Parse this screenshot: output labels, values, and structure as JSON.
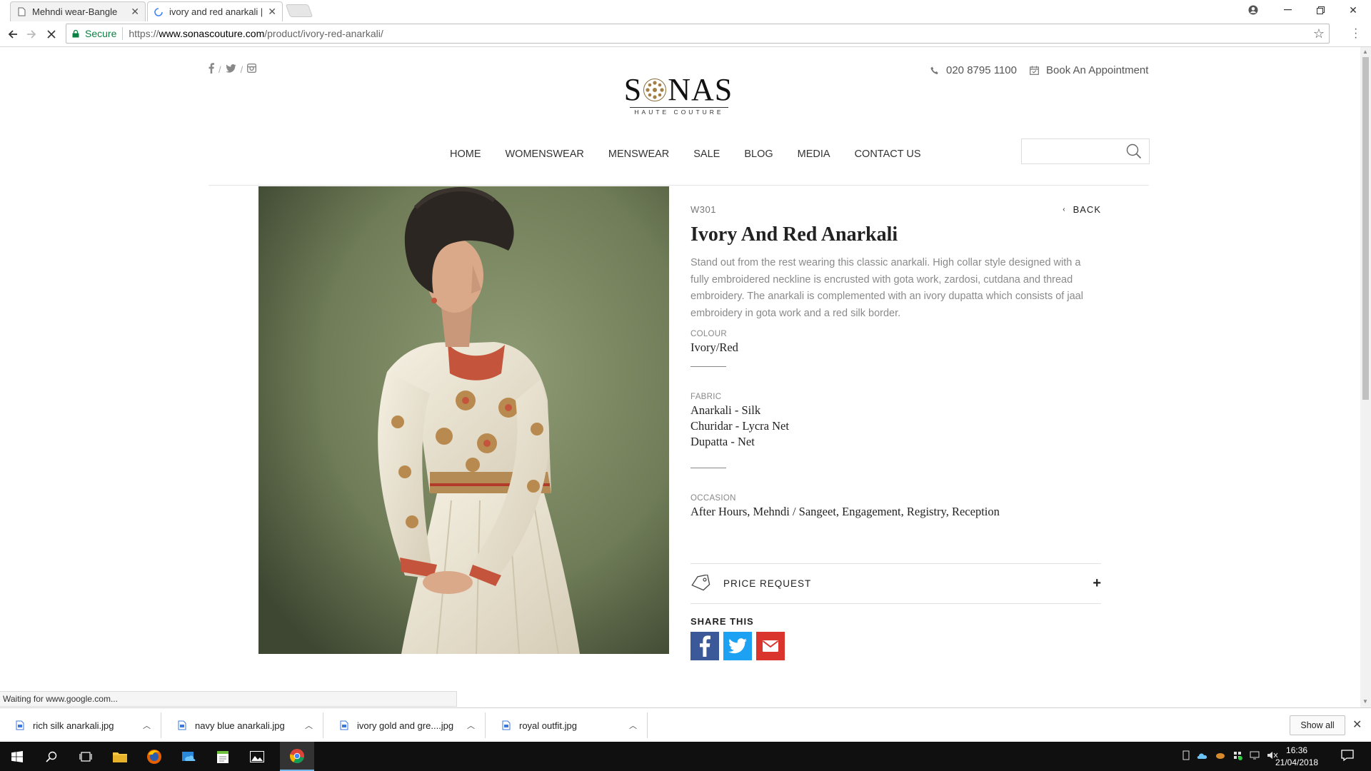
{
  "browser": {
    "tabs": [
      {
        "title": "Mehndi wear-Bangle",
        "active": false
      },
      {
        "title": "ivory and red anarkali | So",
        "active": true
      }
    ],
    "secure_label": "Secure",
    "url_scheme": "https://",
    "url_host": "www.sonascouture.com",
    "url_path": "/product/ivory-red-anarkali/",
    "status": "Waiting for www.google.com..."
  },
  "site": {
    "phone": "020 8795 1100",
    "appointment": "Book An Appointment",
    "logo_text": "SONAS",
    "logo_sub": "HAUTE COUTURE",
    "nav": [
      "HOME",
      "WOMENSWEAR",
      "MENSWEAR",
      "SALE",
      "BLOG",
      "MEDIA",
      "CONTACT US"
    ],
    "search_placeholder": ""
  },
  "product": {
    "sku": "W301",
    "back_label": "BACK",
    "title": "Ivory And Red Anarkali",
    "description": "Stand out from the rest wearing this classic anarkali. High collar style designed with a fully embroidered neckline is encrusted with gota work, zardosi, cutdana and thread embroidery. The anarkali is complemented with an ivory dupatta which consists of jaal embroidery in gota work and a red silk border.",
    "colour_label": "COLOUR",
    "colour": "Ivory/Red",
    "fabric_label": "FABRIC",
    "fabric": [
      "Anarkali - Silk",
      "Churidar - Lycra Net",
      "Dupatta - Net"
    ],
    "occasion_label": "OCCASION",
    "occasion": "After Hours, Mehndi / Sangeet, Engagement, Registry, Reception",
    "price_request": "PRICE REQUEST",
    "plus": "+",
    "share_label": "SHARE THIS"
  },
  "downloads": {
    "items": [
      "rich silk anarkali.jpg",
      "navy blue anarkali.jpg",
      "ivory gold and gre....jpg",
      "royal outfit.jpg"
    ],
    "show_all": "Show all"
  },
  "taskbar": {
    "time": "16:36",
    "date": "21/04/2018"
  },
  "colors": {
    "facebook": "#3b5998",
    "twitter": "#1da1f2",
    "email": "#d9352d",
    "secure_green": "#0b8043",
    "image_background": "#7b8a63"
  }
}
